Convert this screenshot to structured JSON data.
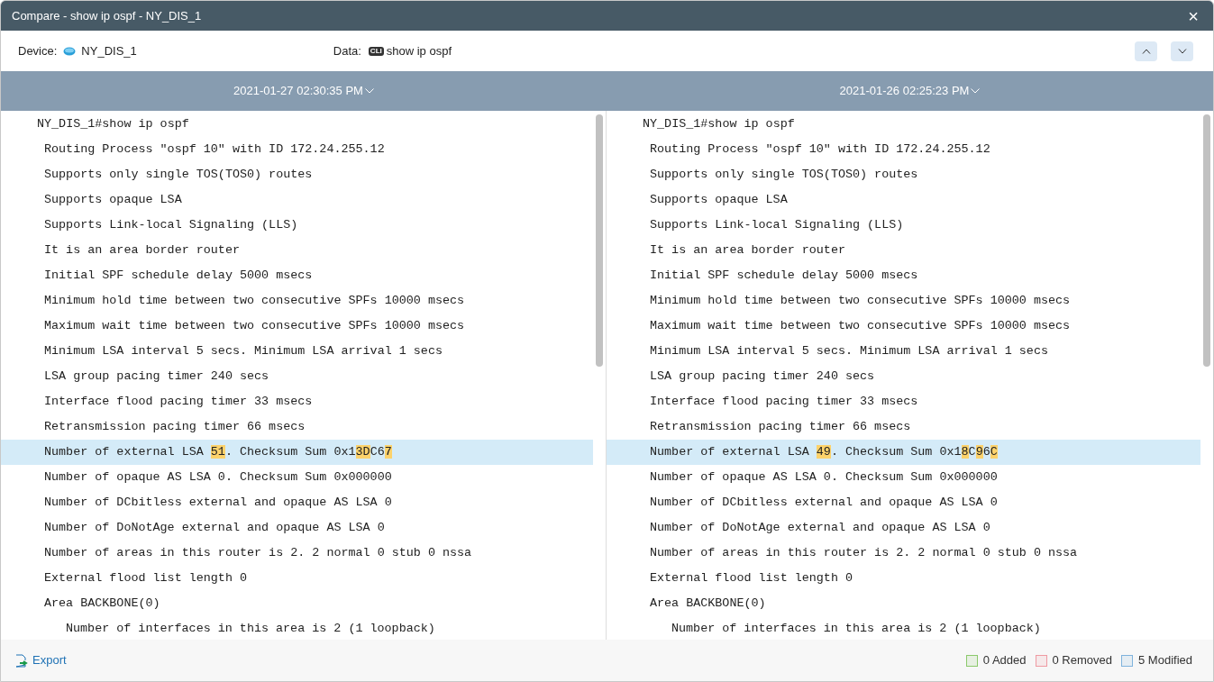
{
  "window": {
    "title": "Compare - show ip ospf - NY_DIS_1",
    "close": "×"
  },
  "info": {
    "device_label": "Device:",
    "device": "NY_DIS_1",
    "data_label": "Data:",
    "data_badge": "CLI",
    "data": "show ip ospf"
  },
  "panes": [
    {
      "date": "2021-01-27 02:30:35 PM",
      "lines": [
        {
          "kind": "prompt",
          "segments": [
            {
              "text": "NY_DIS_1#show ip ospf",
              "changed": false
            }
          ]
        },
        {
          "kind": "line",
          "segments": [
            {
              "text": "Routing Process \"ospf 10\" with ID 172.24.255.12",
              "changed": false
            }
          ]
        },
        {
          "kind": "line",
          "segments": [
            {
              "text": "Supports only single TOS(TOS0) routes",
              "changed": false
            }
          ]
        },
        {
          "kind": "line",
          "segments": [
            {
              "text": "Supports opaque LSA",
              "changed": false
            }
          ]
        },
        {
          "kind": "line",
          "segments": [
            {
              "text": "Supports Link-local Signaling (LLS)",
              "changed": false
            }
          ]
        },
        {
          "kind": "line",
          "segments": [
            {
              "text": "It is an area border router",
              "changed": false
            }
          ]
        },
        {
          "kind": "line",
          "segments": [
            {
              "text": "Initial SPF schedule delay 5000 msecs",
              "changed": false
            }
          ]
        },
        {
          "kind": "line",
          "segments": [
            {
              "text": "Minimum hold time between two consecutive SPFs 10000 msecs",
              "changed": false
            }
          ]
        },
        {
          "kind": "line",
          "segments": [
            {
              "text": "Maximum wait time between two consecutive SPFs 10000 msecs",
              "changed": false
            }
          ]
        },
        {
          "kind": "line",
          "segments": [
            {
              "text": "Minimum LSA interval 5 secs. Minimum LSA arrival 1 secs",
              "changed": false
            }
          ]
        },
        {
          "kind": "line",
          "segments": [
            {
              "text": "LSA group pacing timer 240 secs",
              "changed": false
            }
          ]
        },
        {
          "kind": "line",
          "segments": [
            {
              "text": "Interface flood pacing timer 33 msecs",
              "changed": false
            }
          ]
        },
        {
          "kind": "line",
          "segments": [
            {
              "text": "Retransmission pacing timer 66 msecs",
              "changed": false
            }
          ]
        },
        {
          "kind": "line",
          "modified": true,
          "segments": [
            {
              "text": "Number of external LSA ",
              "changed": false
            },
            {
              "text": "51",
              "changed": true
            },
            {
              "text": ". Checksum Sum 0x1",
              "changed": false
            },
            {
              "text": "3D",
              "changed": true
            },
            {
              "text": "C6",
              "changed": false
            },
            {
              "text": "7",
              "changed": true
            }
          ]
        },
        {
          "kind": "line",
          "segments": [
            {
              "text": "Number of opaque AS LSA 0. Checksum Sum 0x000000",
              "changed": false
            }
          ]
        },
        {
          "kind": "line",
          "segments": [
            {
              "text": "Number of DCbitless external and opaque AS LSA 0",
              "changed": false
            }
          ]
        },
        {
          "kind": "line",
          "segments": [
            {
              "text": "Number of DoNotAge external and opaque AS LSA 0",
              "changed": false
            }
          ]
        },
        {
          "kind": "line",
          "segments": [
            {
              "text": "Number of areas in this router is 2. 2 normal 0 stub 0 nssa",
              "changed": false
            }
          ]
        },
        {
          "kind": "line",
          "segments": [
            {
              "text": "External flood list length 0",
              "changed": false
            }
          ]
        },
        {
          "kind": "line",
          "segments": [
            {
              "text": "Area BACKBONE(0)",
              "changed": false
            }
          ],
          "children": [
            {
              "kind": "line",
              "segments": [
                {
                  "text": "Number of interfaces in this area is 2 (1 loopback)",
                  "changed": false
                }
              ]
            }
          ]
        }
      ]
    },
    {
      "date": "2021-01-26 02:25:23 PM",
      "lines": [
        {
          "kind": "prompt",
          "segments": [
            {
              "text": "NY_DIS_1#show ip ospf",
              "changed": false
            }
          ]
        },
        {
          "kind": "line",
          "segments": [
            {
              "text": "Routing Process \"ospf 10\" with ID 172.24.255.12",
              "changed": false
            }
          ]
        },
        {
          "kind": "line",
          "segments": [
            {
              "text": "Supports only single TOS(TOS0) routes",
              "changed": false
            }
          ]
        },
        {
          "kind": "line",
          "segments": [
            {
              "text": "Supports opaque LSA",
              "changed": false
            }
          ]
        },
        {
          "kind": "line",
          "segments": [
            {
              "text": "Supports Link-local Signaling (LLS)",
              "changed": false
            }
          ]
        },
        {
          "kind": "line",
          "segments": [
            {
              "text": "It is an area border router",
              "changed": false
            }
          ]
        },
        {
          "kind": "line",
          "segments": [
            {
              "text": "Initial SPF schedule delay 5000 msecs",
              "changed": false
            }
          ]
        },
        {
          "kind": "line",
          "segments": [
            {
              "text": "Minimum hold time between two consecutive SPFs 10000 msecs",
              "changed": false
            }
          ]
        },
        {
          "kind": "line",
          "segments": [
            {
              "text": "Maximum wait time between two consecutive SPFs 10000 msecs",
              "changed": false
            }
          ]
        },
        {
          "kind": "line",
          "segments": [
            {
              "text": "Minimum LSA interval 5 secs. Minimum LSA arrival 1 secs",
              "changed": false
            }
          ]
        },
        {
          "kind": "line",
          "segments": [
            {
              "text": "LSA group pacing timer 240 secs",
              "changed": false
            }
          ]
        },
        {
          "kind": "line",
          "segments": [
            {
              "text": "Interface flood pacing timer 33 msecs",
              "changed": false
            }
          ]
        },
        {
          "kind": "line",
          "segments": [
            {
              "text": "Retransmission pacing timer 66 msecs",
              "changed": false
            }
          ]
        },
        {
          "kind": "line",
          "modified": true,
          "segments": [
            {
              "text": "Number of external LSA ",
              "changed": false
            },
            {
              "text": "49",
              "changed": true
            },
            {
              "text": ". Checksum Sum 0x1",
              "changed": false
            },
            {
              "text": "8",
              "changed": true
            },
            {
              "text": "C",
              "changed": false
            },
            {
              "text": "9",
              "changed": true
            },
            {
              "text": "6",
              "changed": false
            },
            {
              "text": "C",
              "changed": true
            }
          ]
        },
        {
          "kind": "line",
          "segments": [
            {
              "text": "Number of opaque AS LSA 0. Checksum Sum 0x000000",
              "changed": false
            }
          ]
        },
        {
          "kind": "line",
          "segments": [
            {
              "text": "Number of DCbitless external and opaque AS LSA 0",
              "changed": false
            }
          ]
        },
        {
          "kind": "line",
          "segments": [
            {
              "text": "Number of DoNotAge external and opaque AS LSA 0",
              "changed": false
            }
          ]
        },
        {
          "kind": "line",
          "segments": [
            {
              "text": "Number of areas in this router is 2. 2 normal 0 stub 0 nssa",
              "changed": false
            }
          ]
        },
        {
          "kind": "line",
          "segments": [
            {
              "text": "External flood list length 0",
              "changed": false
            }
          ]
        },
        {
          "kind": "line",
          "segments": [
            {
              "text": "Area BACKBONE(0)",
              "changed": false
            }
          ],
          "children": [
            {
              "kind": "line",
              "segments": [
                {
                  "text": "Number of interfaces in this area is 2 (1 loopback)",
                  "changed": false
                }
              ]
            }
          ]
        }
      ]
    }
  ],
  "footer": {
    "export": "Export",
    "legend": [
      {
        "label": "0 Added",
        "color": "#8bc96b"
      },
      {
        "label": "0 Removed",
        "color": "#ef9aa2"
      },
      {
        "label": "5 Modified",
        "color": "#7fb3dc"
      }
    ]
  }
}
